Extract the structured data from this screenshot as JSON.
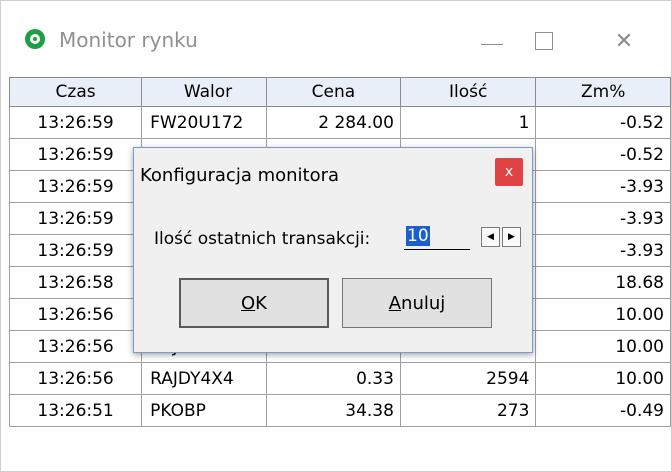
{
  "window": {
    "title": "Monitor rynku",
    "minimize_glyph": "—",
    "close_glyph": "✕",
    "icon": "monitor-app-icon"
  },
  "table": {
    "columns": [
      "Czas",
      "Walor",
      "Cena",
      "Ilość",
      "Zm%"
    ],
    "rows": [
      [
        "13:26:59",
        "FW20U172",
        "2 284.00",
        "1",
        "-0.52"
      ],
      [
        "13:26:59",
        "",
        "",
        "",
        "-0.52"
      ],
      [
        "13:26:59",
        "",
        "",
        "",
        "-3.93"
      ],
      [
        "13:26:59",
        "",
        "",
        "",
        "-3.93"
      ],
      [
        "13:26:59",
        "",
        "",
        "",
        "-3.93"
      ],
      [
        "13:26:58",
        "",
        "",
        "",
        "18.68"
      ],
      [
        "13:26:56",
        "",
        "",
        "",
        "10.00"
      ],
      [
        "13:26:56",
        "RAJDY4X4",
        "0.33",
        "5000",
        "10.00"
      ],
      [
        "13:26:56",
        "RAJDY4X4",
        "0.33",
        "2594",
        "10.00"
      ],
      [
        "13:26:51",
        "PKOBP",
        "34.38",
        "273",
        "-0.49"
      ]
    ]
  },
  "dialog": {
    "title": "Konfiguracja monitora",
    "close_glyph": "x",
    "field_label": "Ilość ostatnich transakcji:",
    "field_value": "10",
    "spin_left": "◀",
    "spin_right": "▶",
    "ok_accel": "O",
    "ok_rest": "K",
    "cancel_accel": "A",
    "cancel_rest": "nuluj"
  },
  "colors": {
    "header_bg": "#e9eff8",
    "dialog_close_bg": "#e04343",
    "dialog_border": "#7a9cc6",
    "selection": "#1b5fcf"
  }
}
